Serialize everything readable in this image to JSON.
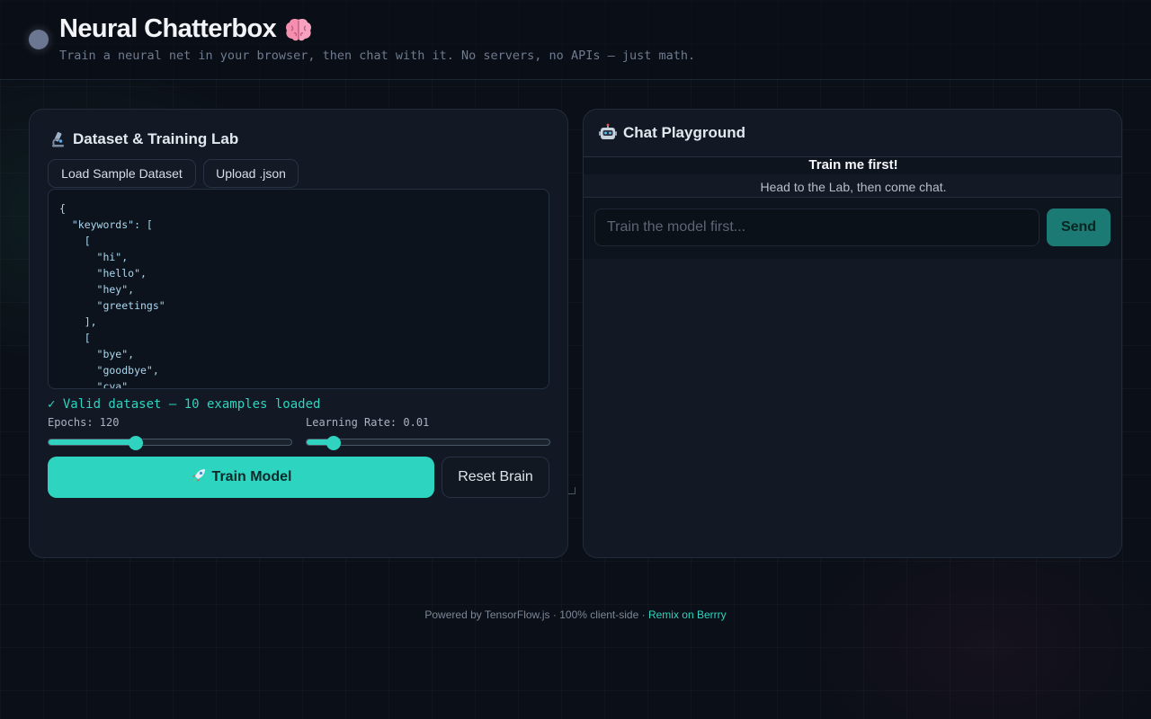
{
  "header": {
    "title": "Neural Chatterbox",
    "title_icon": "brain-icon",
    "subtitle": "Train a neural net in your browser, then chat with it. No servers, no APIs — just math."
  },
  "lab": {
    "title": "Dataset & Training Lab",
    "title_icon": "microscope-icon",
    "load_sample_label": "Load Sample Dataset",
    "upload_label": "Upload .json",
    "dataset_text": "{\n  \"keywords\": [\n    [\n      \"hi\",\n      \"hello\",\n      \"hey\",\n      \"greetings\"\n    ],\n    [\n      \"bye\",\n      \"goodbye\",\n      \"cya\",",
    "valid_message": "✓ Valid dataset — 10 examples loaded",
    "epochs_label": "Epochs: 120",
    "epochs_fraction": 0.36,
    "learning_rate_label": "Learning Rate: 0.01",
    "learning_rate_fraction": 0.11,
    "train_label": "Train Model",
    "train_icon": "rocket-icon",
    "reset_label": "Reset Brain"
  },
  "chat": {
    "title": "Chat Playground",
    "title_icon": "robot-icon",
    "banner_title": "Train me first!",
    "banner_subtitle": "Head to the Lab, then come chat.",
    "input_placeholder": "Train the model first...",
    "send_label": "Send"
  },
  "footer": {
    "text": "Powered by TensorFlow.js · 100% client-side · ",
    "link": "Remix on Berrry"
  },
  "colors": {
    "accent": "#2dd4bf",
    "background": "#0b0f17",
    "panel": "#121924"
  }
}
